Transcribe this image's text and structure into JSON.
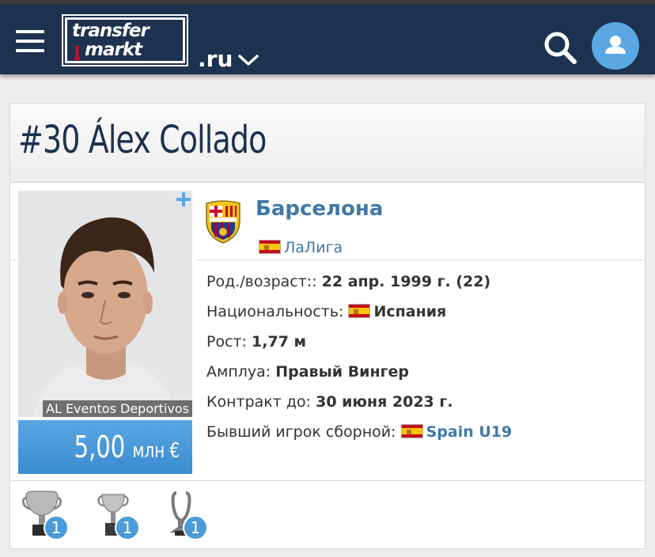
{
  "header": {
    "logo_line1": "transfer",
    "logo_line2": "markt",
    "domain": ".ru",
    "icons": {
      "menu": "menu-icon",
      "search": "search-icon",
      "user": "user-icon",
      "dropdown": "chevron-down-icon"
    },
    "colors": {
      "header_bg": "#1d3150",
      "accent": "#5aa7e3"
    }
  },
  "player": {
    "number": "#30",
    "first_name": "Álex",
    "last_name": "Collado",
    "photo_credit": "AL Eventos Deportivos",
    "market_value": "5,00",
    "market_value_unit": "млн €"
  },
  "club": {
    "name": "Барселона",
    "league": "ЛаЛига"
  },
  "info": {
    "birth_label": "Род./возраст::",
    "birth_value": "22 апр. 1999 г. (22)",
    "nationality_label": "Национальность:",
    "nationality_value": "Испания",
    "height_label": "Рост:",
    "height_value": "1,77 м",
    "position_label": "Амплуа:",
    "position_value": "Правый Вингер",
    "contract_label": "Контракт до:",
    "contract_value": "30 июня 2023 г.",
    "former_label": "Бывший игрок сборной:",
    "former_value": "Spain U19"
  },
  "trophies": [
    {
      "icon": "laliga-trophy-icon",
      "count": "1"
    },
    {
      "icon": "cup-trophy-icon",
      "count": "1"
    },
    {
      "icon": "supercup-trophy-icon",
      "count": "1"
    }
  ]
}
